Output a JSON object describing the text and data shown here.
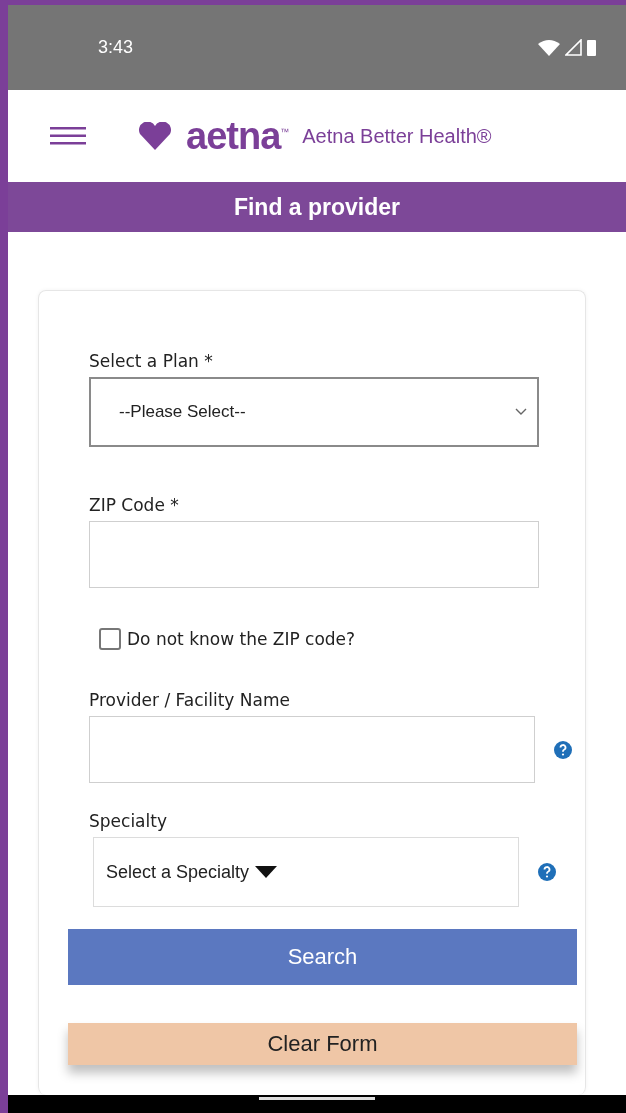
{
  "status_bar": {
    "time": "3:43"
  },
  "header": {
    "logo": "aetna$^{™}$",
    "brand": "Aetna Better Health®"
  },
  "banner": {
    "title": "Find a provider"
  },
  "form": {
    "fields": [
      {
        "kind": "select",
        "label": "Select a Plan *",
        "value": "--Please Select--",
        "help": false
      },
      {
        "kind": "text",
        "label": "ZIP Code *",
        "help": false
      },
      {
        "kind": "checkbox",
        "label": "Do not know the ZIP code?",
        "checked": false
      },
      {
        "kind": "text",
        "label": "Provider / Facility Name",
        "help": true
      },
      {
        "kind": "specialty",
        "label": "Specialty",
        "value": "Select a Specialty",
        "help": true
      }
    ],
    "buttons": [
      {
        "kind": "primary",
        "label": "Search"
      },
      {
        "kind": "secondary",
        "label": "Clear Form"
      }
    ]
  }
}
